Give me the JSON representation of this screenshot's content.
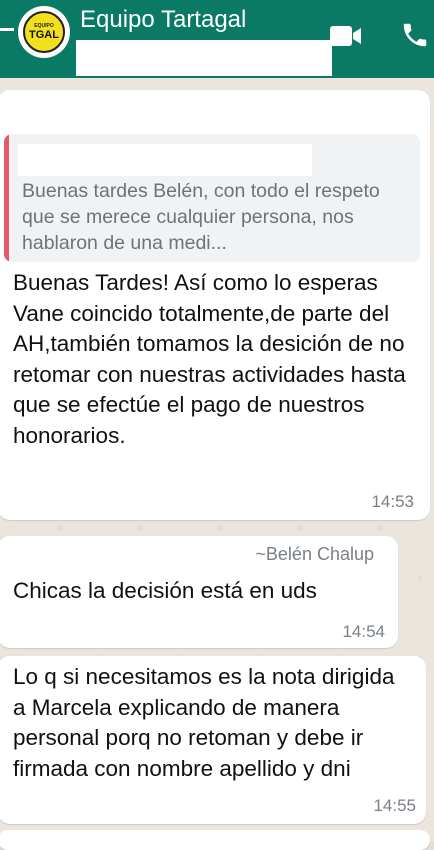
{
  "header": {
    "title": "Equipo Tartagal",
    "avatar_line1": "EQUIPO",
    "avatar_line2": "TGAL",
    "back_icon": "back-arrow-icon",
    "video_icon": "video-call-icon",
    "phone_icon": "voice-call-icon",
    "color": "#0a7a64"
  },
  "messages": [
    {
      "quote_text": "Buenas tardes Belén, con todo el respeto que se merece cualquier persona, nos hablaron de una medi...",
      "text": "Buenas Tardes! Así como lo esperas Vane coincido totalmente,de parte del AH,también tomamos la desición de no retomar con nuestras actividades hasta que se efectúe el pago de nuestros honorarios.",
      "time": "14:53"
    },
    {
      "sender": "~Belén Chalup",
      "text": "Chicas la decisión está en uds",
      "time": "14:54"
    },
    {
      "text": "Lo q si necesitamos es la nota dirigida a Marcela explicando de manera personal porq no retoman y debe ir firmada con nombre apellido y dni",
      "time": "14:55"
    }
  ],
  "colors": {
    "quote_bar": "#e05c6d",
    "bubble": "#ffffff",
    "wallpaper": "#ece5dd"
  }
}
